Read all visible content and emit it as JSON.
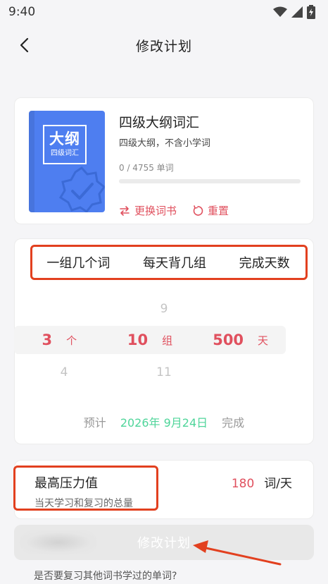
{
  "status_bar": {
    "time": "9:40"
  },
  "header": {
    "title": "修改计划",
    "back_icon": "chevron-left-icon"
  },
  "book": {
    "cover_big": "大纲",
    "cover_small": "四级词汇",
    "title": "四级大纲词汇",
    "subtitle": "四级大纲，不含小学词",
    "progress_text": "0 / 4755 单词",
    "learned": 0,
    "total": 4755,
    "change_label": "更换词书",
    "reset_label": "重置"
  },
  "picker": {
    "headers": [
      "一组几个词",
      "每天背几组",
      "完成天数"
    ],
    "prev": [
      "",
      "9",
      ""
    ],
    "selected": [
      {
        "value": "3",
        "unit": "个"
      },
      {
        "value": "10",
        "unit": "组"
      },
      {
        "value": "500",
        "unit": "天"
      }
    ],
    "next": [
      "4",
      "11",
      ""
    ]
  },
  "estimate": {
    "prefix": "预计",
    "date": "2026年 9月24日",
    "suffix": "完成"
  },
  "pressure": {
    "title": "最高压力值",
    "description": "当天学习和复习的总量",
    "value": "180",
    "unit": "词/天"
  },
  "modify_button": {
    "label": "修改计划"
  },
  "review_question": "是否要复习其他词书学过的单词?",
  "colors": {
    "accent_red": "#e0505e",
    "estimate_green": "#4fd59a",
    "book_blue": "#4e7ef0",
    "annotation_red": "#e2401f"
  }
}
